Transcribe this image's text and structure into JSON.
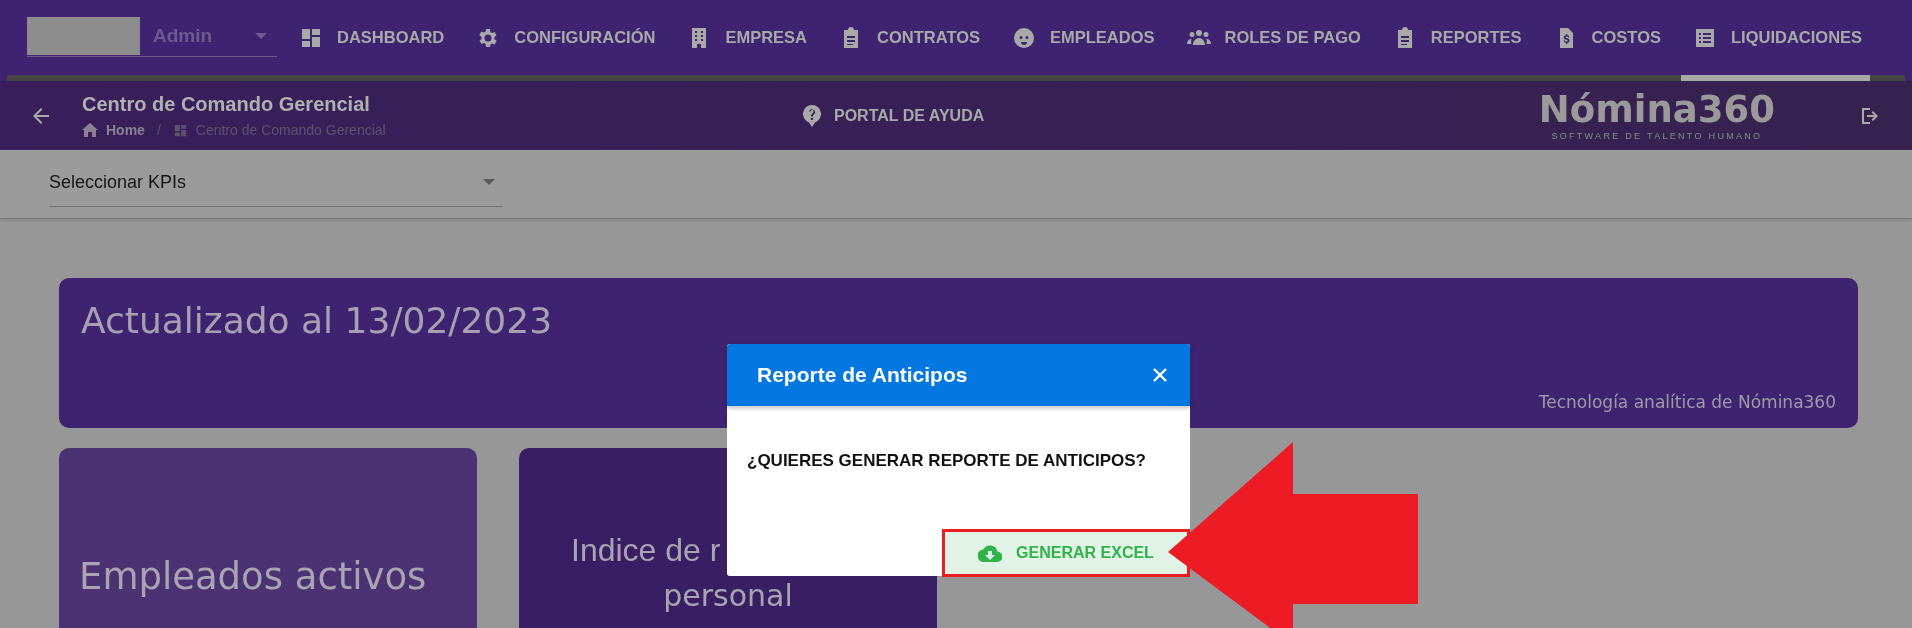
{
  "user_menu": {
    "label": "Admin"
  },
  "nav_tabs": [
    {
      "label": "DASHBOARD",
      "selected": false
    },
    {
      "label": "CONFIGURACIÓN",
      "selected": false
    },
    {
      "label": "EMPRESA",
      "selected": false
    },
    {
      "label": "CONTRATOS",
      "selected": false
    },
    {
      "label": "EMPLEADOS",
      "selected": false
    },
    {
      "label": "ROLES DE PAGO",
      "selected": false
    },
    {
      "label": "REPORTES",
      "selected": false
    },
    {
      "label": "COSTOS",
      "selected": false
    },
    {
      "label": "LIQUIDACIONES",
      "selected": true
    }
  ],
  "page_header": {
    "title": "Centro de Comando Gerencial",
    "breadcrumb": [
      "Home",
      "Centro de Comando Gerencial"
    ],
    "breadcrumb_separator": "/"
  },
  "help_link": "PORTAL DE AYUDA",
  "logo": {
    "name": "Nómina360",
    "tagline": "SOFTWARE DE TALENTO HUMANO"
  },
  "kpi_select": {
    "value": "Seleccionar KPIs"
  },
  "banner": {
    "title": "Actualizado al 13/02/2023",
    "caption": "Tecnología analítica de Nómina360"
  },
  "kpi_cards": [
    {
      "lines": [
        "Empleados activos"
      ]
    },
    {
      "lines": [
        "Indice de r",
        "personal"
      ]
    }
  ],
  "dialog": {
    "title": "Reporte de Anticipos",
    "message": "¿QUIERES GENERAR REPORTE DE ANTICIPOS?",
    "button": "GENERAR EXCEL"
  }
}
